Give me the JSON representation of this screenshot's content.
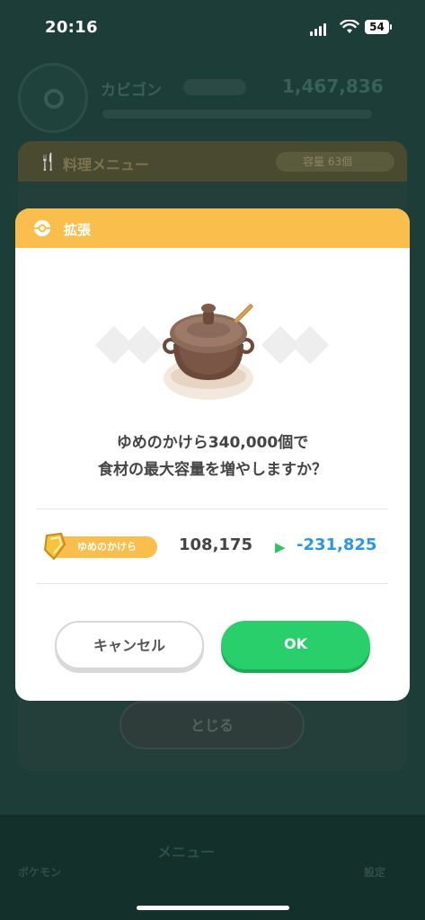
{
  "status_bar": {
    "time": "20:16",
    "battery": "54"
  },
  "background": {
    "profile": {
      "name": "カビゴン",
      "count": "1,467,836"
    },
    "panel": {
      "title": "料理メニュー",
      "capacity": "容量 63個",
      "close_label": "とじる"
    },
    "nav": {
      "menu_label": "メニュー",
      "left_label": "ポケモン",
      "right_label": "設定"
    }
  },
  "modal": {
    "title": "拡張",
    "question_line1": "ゆめのかけら340,000個で",
    "question_line2": "食材の最大容量を増やしますか？",
    "resource_label": "ゆめのかけら",
    "current_value": "108,175",
    "new_value": "-231,825",
    "cancel_label": "キャンセル",
    "ok_label": "OK"
  },
  "colors": {
    "header": "#f9be4c",
    "ok_button": "#28cf6b",
    "new_value": "#2a96e6",
    "arrow": "#33c161"
  },
  "icons": {
    "header": "pokeball-icon",
    "illustration": "pot-icon",
    "resource": "dream-shard-icon",
    "arrow": "play-arrow-icon"
  }
}
